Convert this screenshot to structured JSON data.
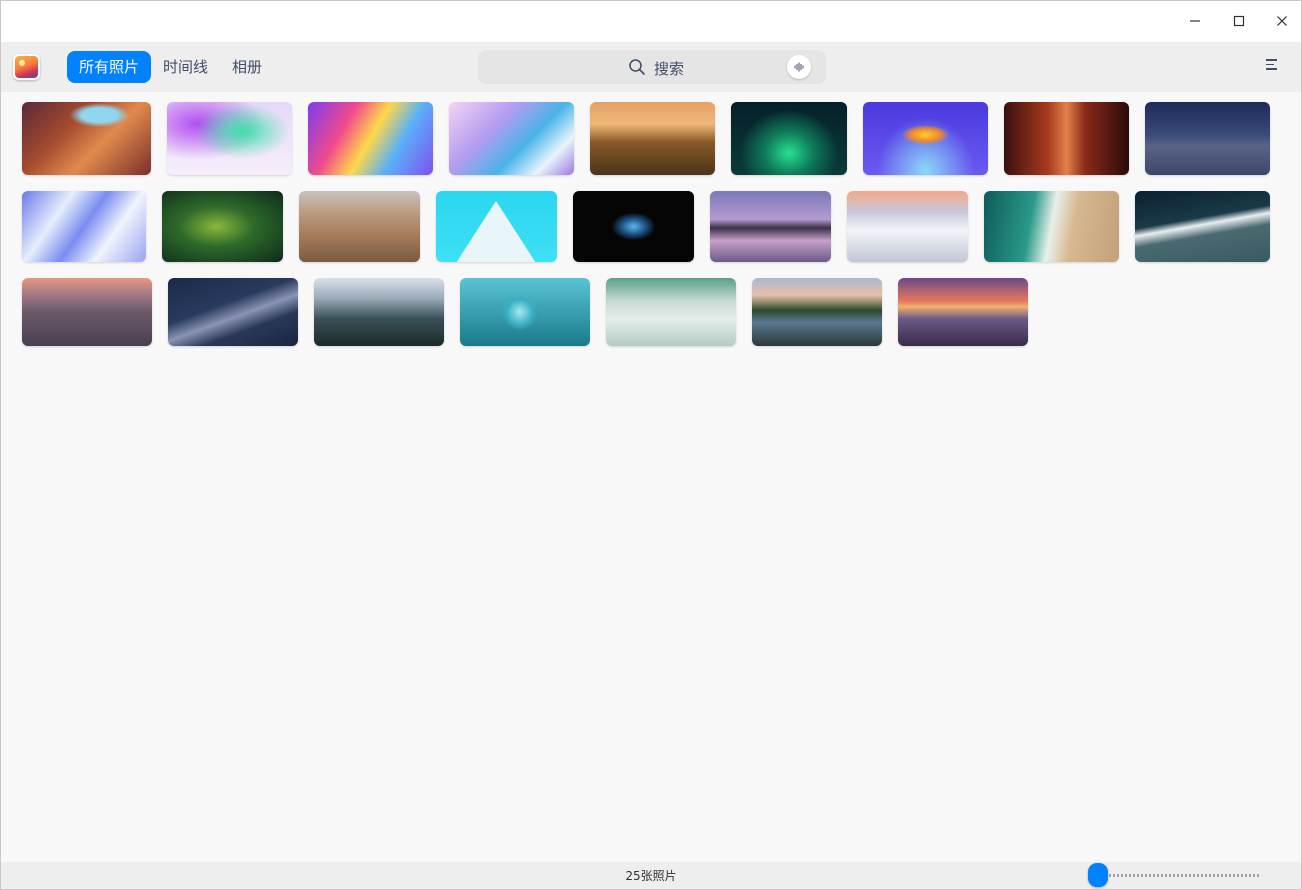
{
  "toolbar": {
    "tabs": [
      {
        "label": "所有照片",
        "active": true
      },
      {
        "label": "时间线",
        "active": false
      },
      {
        "label": "相册",
        "active": false
      }
    ],
    "search_placeholder": "搜索"
  },
  "status": {
    "photo_count": "25张照片",
    "zoom_level": 0
  },
  "colors": {
    "accent": "#0081ff",
    "toolbar_bg": "#eeeeee",
    "content_bg": "#f8f8f8"
  },
  "icons": {
    "app": "photo-app-icon",
    "minimize": "minimize-icon",
    "maximize": "maximize-icon",
    "close": "close-icon",
    "search": "search-icon",
    "voice": "voice-input-icon",
    "menu": "menu-icon"
  }
}
